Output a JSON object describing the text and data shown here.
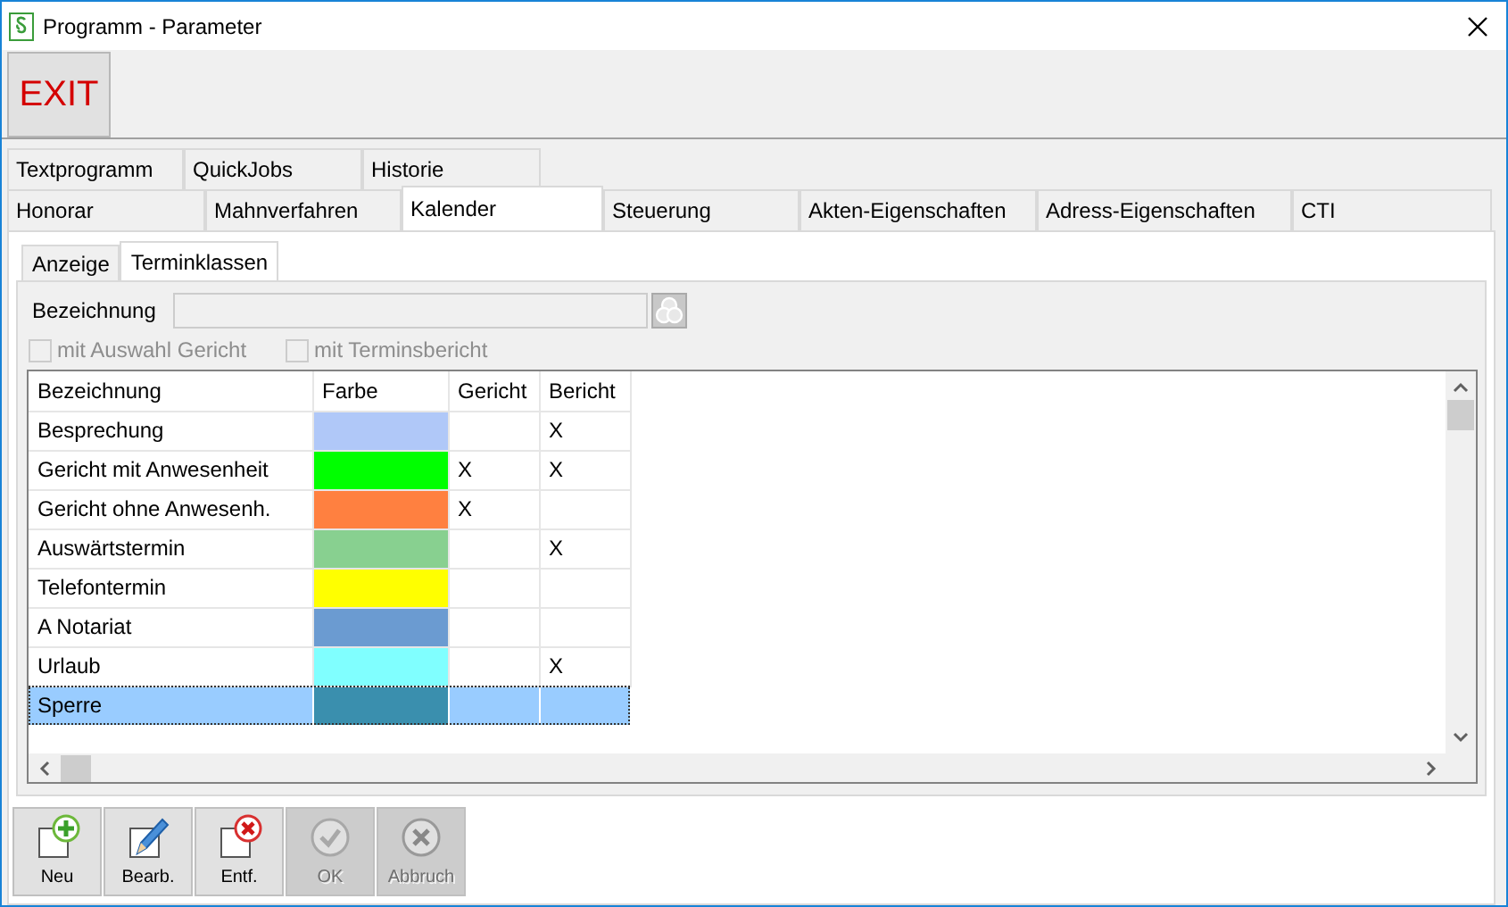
{
  "window": {
    "title": "Programm - Parameter"
  },
  "toolbar": {
    "exit_label": "EXIT"
  },
  "tab_rows": [
    {
      "tabs": [
        {
          "label": "Textprogramm",
          "selected": false
        },
        {
          "label": "QuickJobs",
          "selected": false
        },
        {
          "label": "Historie",
          "selected": false
        }
      ]
    },
    {
      "tabs": [
        {
          "label": "Honorar",
          "selected": false
        },
        {
          "label": "Mahnverfahren",
          "selected": false
        },
        {
          "label": "Kalender",
          "selected": true
        },
        {
          "label": "Steuerung",
          "selected": false
        },
        {
          "label": "Akten-Eigenschaften",
          "selected": false
        },
        {
          "label": "Adress-Eigenschaften",
          "selected": false
        },
        {
          "label": "CTI",
          "selected": false
        }
      ]
    }
  ],
  "subtabs": [
    {
      "label": "Anzeige",
      "selected": false
    },
    {
      "label": "Terminklassen",
      "selected": true
    }
  ],
  "form": {
    "label": "Bezeichnung",
    "disabled": true,
    "checkboxes": [
      {
        "label": "mit Auswahl Gericht",
        "checked": false,
        "disabled": true
      },
      {
        "label": "mit Terminsbericht",
        "checked": false,
        "disabled": true
      }
    ]
  },
  "table": {
    "columns": [
      "Bezeichnung",
      "Farbe",
      "Gericht",
      "Bericht"
    ],
    "rows": [
      {
        "name": "Besprechung",
        "color": "#b0c8f8",
        "bericht": "X",
        "selected": false
      },
      {
        "name": "Gericht mit Anwesenheit",
        "color": "#00ff00",
        "gericht": "X",
        "bericht": "X",
        "selected": false
      },
      {
        "name": "Gericht ohne Anwesenh.",
        "color": "#ff8040",
        "gericht": "X",
        "selected": false
      },
      {
        "name": "Auswärtstermin",
        "color": "#88d090",
        "bericht": "X",
        "selected": false
      },
      {
        "name": "Telefontermin",
        "color": "#ffff00",
        "selected": false
      },
      {
        "name": "A Notariat",
        "color": "#6b9bd1",
        "selected": false
      },
      {
        "name": "Urlaub",
        "color": "#80ffff",
        "bericht": "X",
        "selected": false
      },
      {
        "name": "Sperre",
        "color": "#3a8fae",
        "selected": true
      }
    ]
  },
  "buttons": [
    {
      "label": "Neu",
      "kind": "new",
      "disabled": false
    },
    {
      "label": "Bearb.",
      "kind": "edit",
      "disabled": false
    },
    {
      "label": "Entf.",
      "kind": "delete",
      "disabled": false
    },
    {
      "label": "OK",
      "kind": "ok",
      "disabled": true
    },
    {
      "label": "Abbruch",
      "kind": "cancel",
      "disabled": true
    }
  ]
}
